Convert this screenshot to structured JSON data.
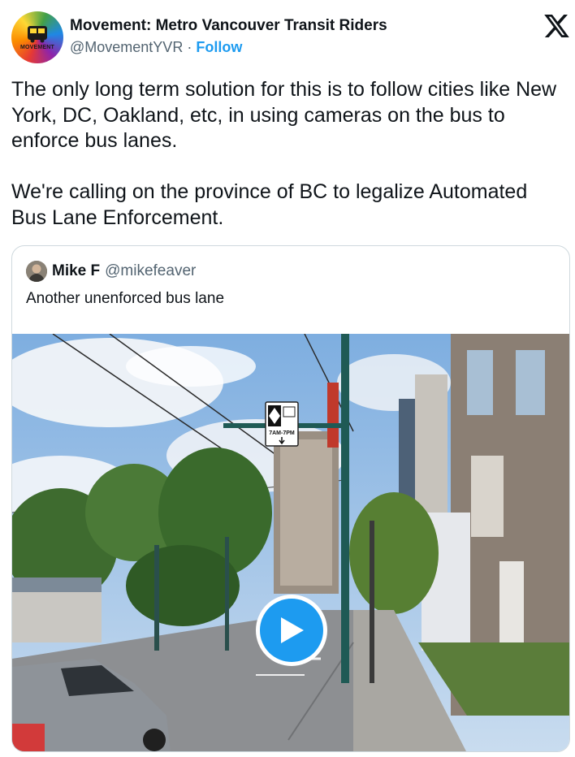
{
  "post": {
    "avatar_text": "MOVEMENT",
    "display_name": "Movement: Metro Vancouver Transit Riders",
    "handle": "@MovementYVR",
    "separator": "·",
    "follow_label": "Follow",
    "text": "The only long term solution for this is to follow cities like New York, DC, Oakland, etc, in using cameras on the bus to enforce bus lanes.\n\nWe're calling on the province of BC to legalize Automated Bus Lane Enforcement."
  },
  "icons": {
    "brand": "x-logo-icon",
    "play": "play-icon"
  },
  "quote": {
    "display_name": "Mike F",
    "handle": "@mikefeaver",
    "text": "Another unenforced bus lane",
    "sign_text": "7AM-7PM"
  },
  "colors": {
    "accent": "#1d9bf0",
    "text_primary": "#0f1419",
    "text_secondary": "#536471",
    "border": "#cfd9de"
  }
}
